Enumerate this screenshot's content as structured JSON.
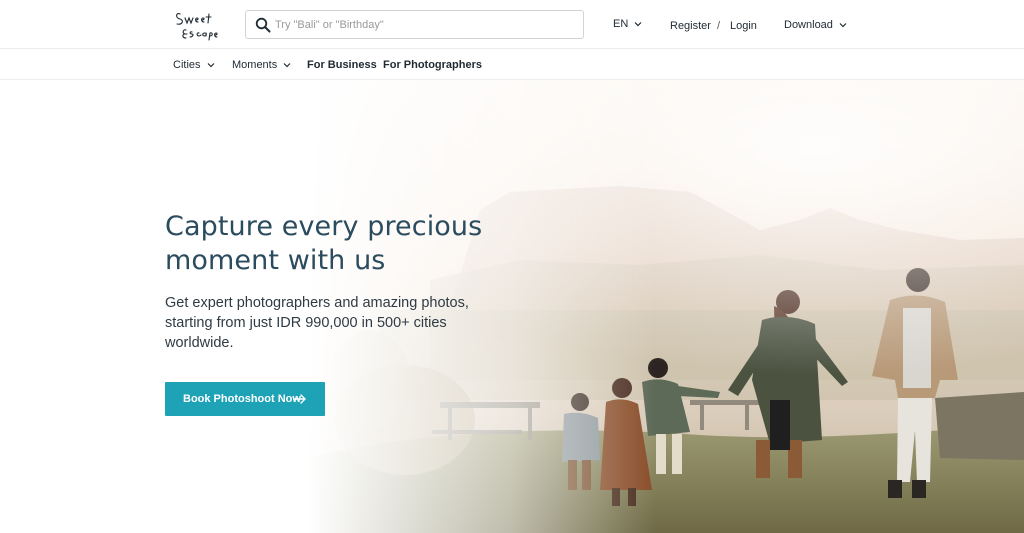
{
  "brand": {
    "logo_text": "Sweet Escape",
    "accent": "#1ea3b6",
    "headline_color": "#2b4b5e"
  },
  "header": {
    "search": {
      "placeholder": "Try \"Bali\" or \"Birthday\"",
      "value": "",
      "icon": "search-icon"
    },
    "language": "EN",
    "register": "Register",
    "separator": "/",
    "login": "Login",
    "download": "Download"
  },
  "subnav": {
    "items": [
      {
        "label": "Cities",
        "dropdown": true
      },
      {
        "label": "Moments",
        "dropdown": true
      },
      {
        "label": "For Business",
        "dropdown": false
      },
      {
        "label": "For Photographers",
        "dropdown": false
      }
    ]
  },
  "hero": {
    "headline_line1": "Capture every precious",
    "headline_line2": "moment with us",
    "subhead_line1": "Get expert photographers and amazing photos,",
    "subhead_line2": "starting from just IDR 990,000 in 500+ cities",
    "subhead_line3": "worldwide.",
    "cta_label": "Book Photoshoot Now",
    "cta_icon": "arrow-right-icon"
  }
}
